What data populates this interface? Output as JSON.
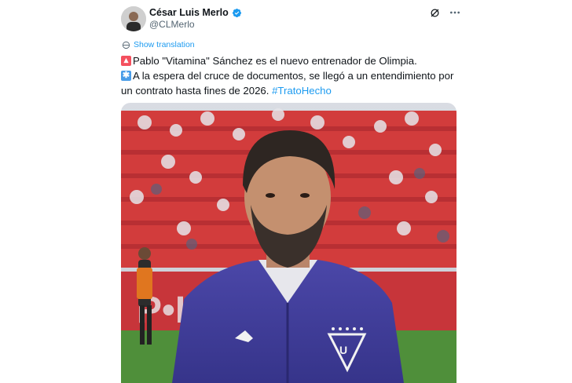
{
  "author": {
    "display_name": "César Luis Merlo",
    "handle": "@CLMerlo",
    "verified": true
  },
  "actions": {
    "grok_icon": "grok-icon",
    "more_icon": "more-icon"
  },
  "translation": {
    "label": "Show translation"
  },
  "tweet": {
    "line1_text": "Pablo \"Vitamina\" Sánchez es el nuevo entrenador de Olimpia.",
    "line2_text": "A la espera del cruce de documentos, se llegó a un entendimiento por un contrato hasta fines de 2026. ",
    "hashtag": "#TratoHecho"
  },
  "colors": {
    "accent": "#1d9bf0",
    "text": "#0f1419",
    "secondary": "#536471"
  }
}
